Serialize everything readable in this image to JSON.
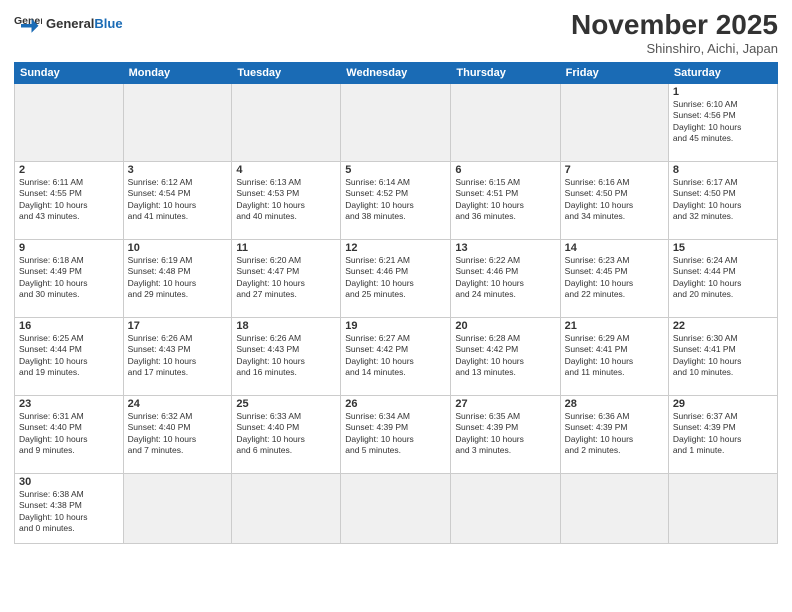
{
  "header": {
    "logo_general": "General",
    "logo_blue": "Blue",
    "month_title": "November 2025",
    "subtitle": "Shinshiro, Aichi, Japan"
  },
  "weekdays": [
    "Sunday",
    "Monday",
    "Tuesday",
    "Wednesday",
    "Thursday",
    "Friday",
    "Saturday"
  ],
  "weeks": [
    [
      {
        "day": "",
        "info": "",
        "empty": true
      },
      {
        "day": "",
        "info": "",
        "empty": true
      },
      {
        "day": "",
        "info": "",
        "empty": true
      },
      {
        "day": "",
        "info": "",
        "empty": true
      },
      {
        "day": "",
        "info": "",
        "empty": true
      },
      {
        "day": "",
        "info": "",
        "empty": true
      },
      {
        "day": "1",
        "info": "Sunrise: 6:10 AM\nSunset: 4:56 PM\nDaylight: 10 hours\nand 45 minutes.",
        "empty": false
      }
    ],
    [
      {
        "day": "2",
        "info": "Sunrise: 6:11 AM\nSunset: 4:55 PM\nDaylight: 10 hours\nand 43 minutes.",
        "empty": false
      },
      {
        "day": "3",
        "info": "Sunrise: 6:12 AM\nSunset: 4:54 PM\nDaylight: 10 hours\nand 41 minutes.",
        "empty": false
      },
      {
        "day": "4",
        "info": "Sunrise: 6:13 AM\nSunset: 4:53 PM\nDaylight: 10 hours\nand 40 minutes.",
        "empty": false
      },
      {
        "day": "5",
        "info": "Sunrise: 6:14 AM\nSunset: 4:52 PM\nDaylight: 10 hours\nand 38 minutes.",
        "empty": false
      },
      {
        "day": "6",
        "info": "Sunrise: 6:15 AM\nSunset: 4:51 PM\nDaylight: 10 hours\nand 36 minutes.",
        "empty": false
      },
      {
        "day": "7",
        "info": "Sunrise: 6:16 AM\nSunset: 4:50 PM\nDaylight: 10 hours\nand 34 minutes.",
        "empty": false
      },
      {
        "day": "8",
        "info": "Sunrise: 6:17 AM\nSunset: 4:50 PM\nDaylight: 10 hours\nand 32 minutes.",
        "empty": false
      }
    ],
    [
      {
        "day": "9",
        "info": "Sunrise: 6:18 AM\nSunset: 4:49 PM\nDaylight: 10 hours\nand 30 minutes.",
        "empty": false
      },
      {
        "day": "10",
        "info": "Sunrise: 6:19 AM\nSunset: 4:48 PM\nDaylight: 10 hours\nand 29 minutes.",
        "empty": false
      },
      {
        "day": "11",
        "info": "Sunrise: 6:20 AM\nSunset: 4:47 PM\nDaylight: 10 hours\nand 27 minutes.",
        "empty": false
      },
      {
        "day": "12",
        "info": "Sunrise: 6:21 AM\nSunset: 4:46 PM\nDaylight: 10 hours\nand 25 minutes.",
        "empty": false
      },
      {
        "day": "13",
        "info": "Sunrise: 6:22 AM\nSunset: 4:46 PM\nDaylight: 10 hours\nand 24 minutes.",
        "empty": false
      },
      {
        "day": "14",
        "info": "Sunrise: 6:23 AM\nSunset: 4:45 PM\nDaylight: 10 hours\nand 22 minutes.",
        "empty": false
      },
      {
        "day": "15",
        "info": "Sunrise: 6:24 AM\nSunset: 4:44 PM\nDaylight: 10 hours\nand 20 minutes.",
        "empty": false
      }
    ],
    [
      {
        "day": "16",
        "info": "Sunrise: 6:25 AM\nSunset: 4:44 PM\nDaylight: 10 hours\nand 19 minutes.",
        "empty": false
      },
      {
        "day": "17",
        "info": "Sunrise: 6:26 AM\nSunset: 4:43 PM\nDaylight: 10 hours\nand 17 minutes.",
        "empty": false
      },
      {
        "day": "18",
        "info": "Sunrise: 6:26 AM\nSunset: 4:43 PM\nDaylight: 10 hours\nand 16 minutes.",
        "empty": false
      },
      {
        "day": "19",
        "info": "Sunrise: 6:27 AM\nSunset: 4:42 PM\nDaylight: 10 hours\nand 14 minutes.",
        "empty": false
      },
      {
        "day": "20",
        "info": "Sunrise: 6:28 AM\nSunset: 4:42 PM\nDaylight: 10 hours\nand 13 minutes.",
        "empty": false
      },
      {
        "day": "21",
        "info": "Sunrise: 6:29 AM\nSunset: 4:41 PM\nDaylight: 10 hours\nand 11 minutes.",
        "empty": false
      },
      {
        "day": "22",
        "info": "Sunrise: 6:30 AM\nSunset: 4:41 PM\nDaylight: 10 hours\nand 10 minutes.",
        "empty": false
      }
    ],
    [
      {
        "day": "23",
        "info": "Sunrise: 6:31 AM\nSunset: 4:40 PM\nDaylight: 10 hours\nand 9 minutes.",
        "empty": false
      },
      {
        "day": "24",
        "info": "Sunrise: 6:32 AM\nSunset: 4:40 PM\nDaylight: 10 hours\nand 7 minutes.",
        "empty": false
      },
      {
        "day": "25",
        "info": "Sunrise: 6:33 AM\nSunset: 4:40 PM\nDaylight: 10 hours\nand 6 minutes.",
        "empty": false
      },
      {
        "day": "26",
        "info": "Sunrise: 6:34 AM\nSunset: 4:39 PM\nDaylight: 10 hours\nand 5 minutes.",
        "empty": false
      },
      {
        "day": "27",
        "info": "Sunrise: 6:35 AM\nSunset: 4:39 PM\nDaylight: 10 hours\nand 3 minutes.",
        "empty": false
      },
      {
        "day": "28",
        "info": "Sunrise: 6:36 AM\nSunset: 4:39 PM\nDaylight: 10 hours\nand 2 minutes.",
        "empty": false
      },
      {
        "day": "29",
        "info": "Sunrise: 6:37 AM\nSunset: 4:39 PM\nDaylight: 10 hours\nand 1 minute.",
        "empty": false
      }
    ],
    [
      {
        "day": "30",
        "info": "Sunrise: 6:38 AM\nSunset: 4:38 PM\nDaylight: 10 hours\nand 0 minutes.",
        "empty": false
      },
      {
        "day": "",
        "info": "",
        "empty": true
      },
      {
        "day": "",
        "info": "",
        "empty": true
      },
      {
        "day": "",
        "info": "",
        "empty": true
      },
      {
        "day": "",
        "info": "",
        "empty": true
      },
      {
        "day": "",
        "info": "",
        "empty": true
      },
      {
        "day": "",
        "info": "",
        "empty": true
      }
    ]
  ]
}
